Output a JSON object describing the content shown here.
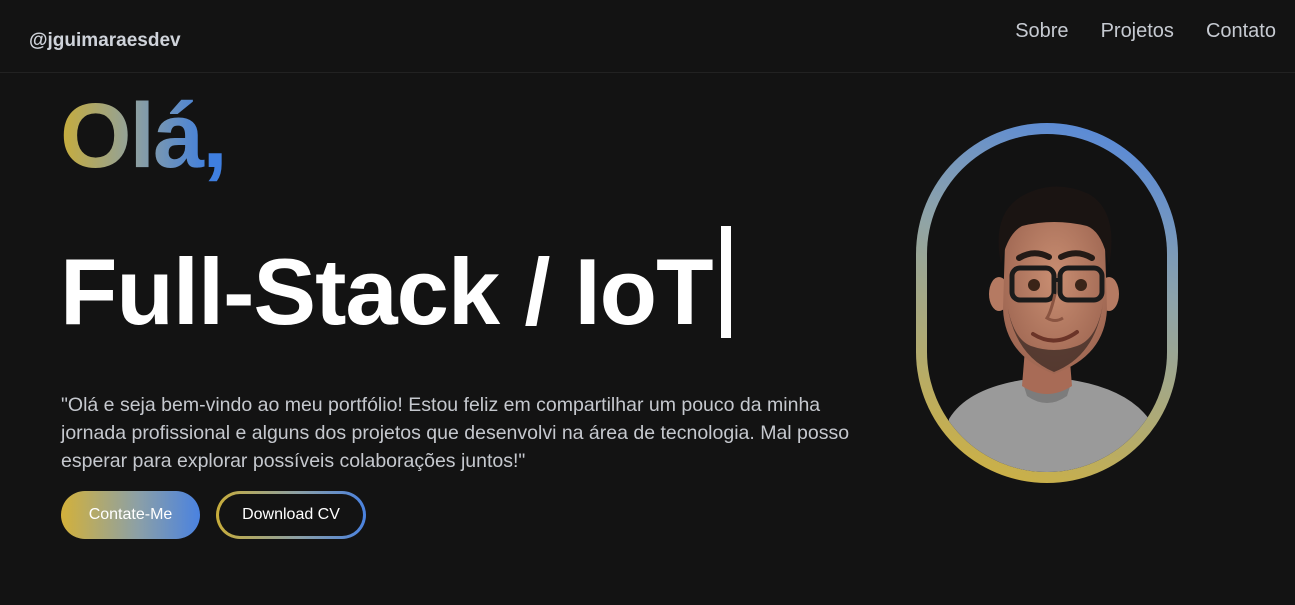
{
  "header": {
    "brand": "@jguimaraesdev",
    "nav": [
      {
        "label": "Sobre"
      },
      {
        "label": "Projetos"
      },
      {
        "label": "Contato"
      }
    ]
  },
  "hero": {
    "greeting": "Olá,",
    "role": "Full-Stack / IoT",
    "intro": "\"Olá e seja bem-vindo ao meu portfólio! Estou feliz em compartilhar um pouco da minha jornada profissional e alguns dos projetos que desenvolvi na área de tecnologia. Mal posso esperar para explorar possíveis colaborações juntos!\"",
    "buttons": {
      "contact": "Contate-Me",
      "download": "Download CV"
    }
  },
  "colors": {
    "background": "#131313",
    "gradient_start": "#d3b13a",
    "gradient_end": "#4a82e0",
    "text": "#ffffff"
  },
  "icons": {
    "avatar": "cartoon-avatar-portrait"
  }
}
